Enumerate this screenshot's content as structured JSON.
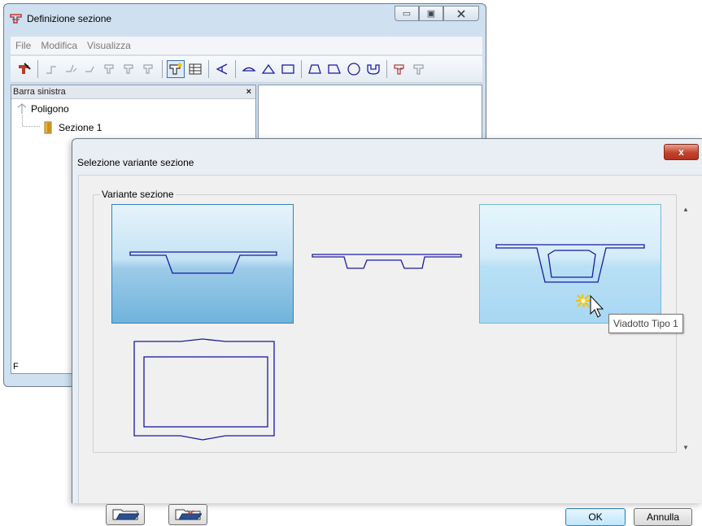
{
  "back_window": {
    "title": "Definizione sezione",
    "menu": [
      "File",
      "Modifica",
      "Visualizza"
    ],
    "sidebar": {
      "title": "Barra sinistra",
      "close_glyph": "×",
      "tree": [
        {
          "label": "Poligono",
          "icon": "polygon-icon"
        },
        {
          "label": "Sezione 1",
          "icon": "section-folder-icon"
        }
      ],
      "footer_text": "F"
    },
    "caption_buttons": {
      "minimize": "minimize-icon",
      "maximize": "maximize-icon",
      "close": "close-icon"
    }
  },
  "dialog": {
    "title": "Selezione variante sezione",
    "close_glyph": "x",
    "group_label": "Variante sezione",
    "variants": [
      {
        "id": "variant-1",
        "state": "selected"
      },
      {
        "id": "variant-2",
        "state": "normal"
      },
      {
        "id": "variant-viadotto-tipo-1",
        "state": "hover"
      },
      {
        "id": "variant-box",
        "state": "normal"
      }
    ],
    "tooltip": "Viadotto Tipo 1",
    "buttons": {
      "ok": "OK",
      "cancel": "Annulla"
    },
    "folder_buttons": [
      "open-folder-icon",
      "save-folder-icon"
    ]
  },
  "colors": {
    "section_line": "#1a1aa0",
    "selected_tile": "#70b3dc",
    "close_red": "#c2432b"
  }
}
